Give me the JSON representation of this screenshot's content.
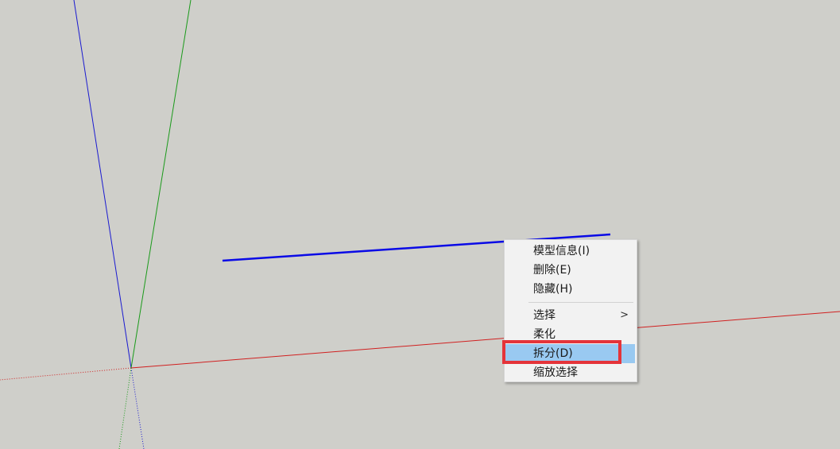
{
  "viewport": {
    "background": "#cfcfca",
    "axis_colors": {
      "red_axis": "#d02020",
      "green_axis": "#1a9a1a",
      "blue_axis": "#1a1ad0",
      "selected_edge": "#0a0ae6"
    }
  },
  "context_menu": {
    "groups": [
      [
        {
          "label": "模型信息(I)"
        },
        {
          "label": "删除(E)"
        },
        {
          "label": "隐藏(H)"
        }
      ],
      [
        {
          "label": "选择",
          "submenu": true,
          "submenu_glyph": ">"
        },
        {
          "label": "柔化"
        },
        {
          "label": "拆分(D)",
          "highlighted": true
        },
        {
          "label": "缩放选择"
        }
      ]
    ],
    "highlight_color": "#99c9f1"
  },
  "annotation": {
    "highlight_box_color": "#e4343a",
    "target_item": "拆分(D)"
  }
}
